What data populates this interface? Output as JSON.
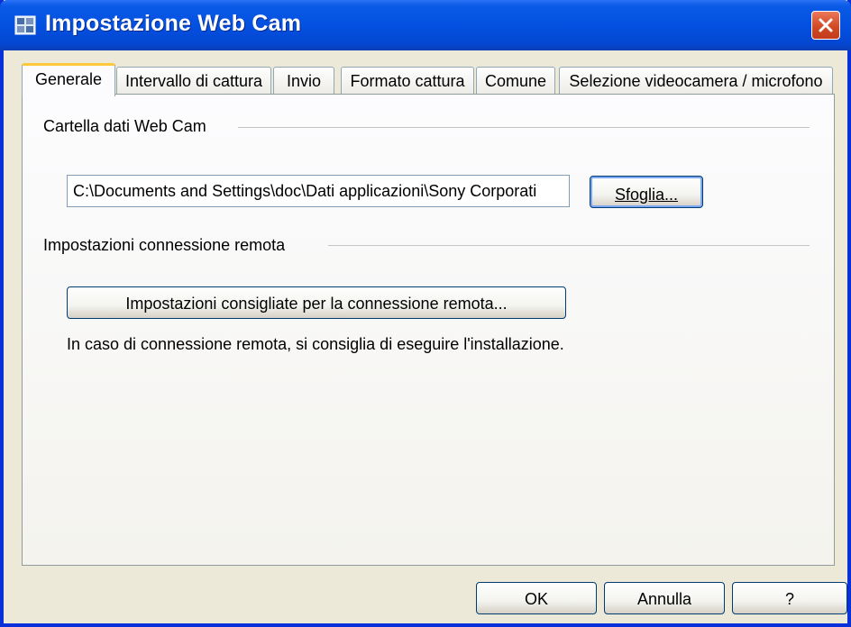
{
  "window": {
    "title": "Impostazione Web Cam",
    "close_icon": "close-icon"
  },
  "tabs": [
    {
      "label": "Generale",
      "active": true
    },
    {
      "label": "Intervallo di cattura",
      "active": false
    },
    {
      "label": "Invio",
      "active": false
    },
    {
      "label": "Formato cattura",
      "active": false
    },
    {
      "label": "Comune",
      "active": false
    },
    {
      "label": "Selezione videocamera / microfono",
      "active": false
    }
  ],
  "general": {
    "folder_group_label": "Cartella dati Web Cam",
    "folder_path": "C:\\Documents and Settings\\doc\\Dati applicazioni\\Sony Corporati",
    "browse_label": "Sfoglia...",
    "remote_group_label": "Impostazioni connessione remota",
    "remote_button_label": "Impostazioni consigliate per la connessione remota...",
    "remote_info_text": "In caso di connessione remota, si consiglia di eseguire l'installazione."
  },
  "footer": {
    "ok_label": "OK",
    "cancel_label": "Annulla",
    "help_label": "?"
  },
  "colors": {
    "titlebar": "#0450E0",
    "active_tab_accent": "#FFC73C",
    "dialog_bg": "#ECE9D8"
  }
}
